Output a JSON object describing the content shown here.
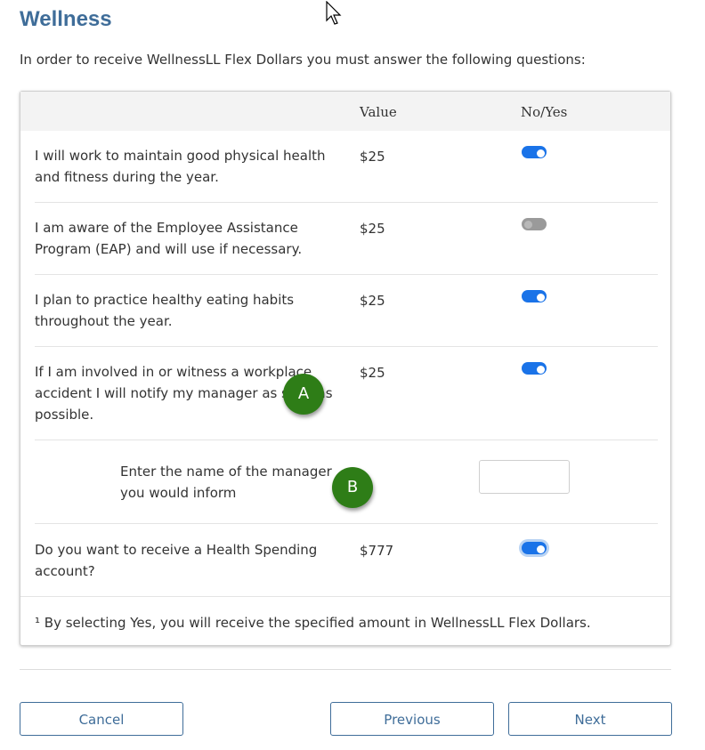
{
  "page": {
    "title": "Wellness",
    "intro": "In order to receive WellnessLL Flex Dollars you must answer the following questions:"
  },
  "table": {
    "headers": {
      "value": "Value",
      "noyes": "No/Yes"
    },
    "rows": [
      {
        "lines": [
          "I will work to maintain good physical health",
          "and fitness during the year."
        ],
        "value": "$25",
        "toggle": "on"
      },
      {
        "lines": [
          "I am aware of the Employee Assistance",
          "Program (EAP) and will use if necessary."
        ],
        "value": "$25",
        "toggle": "off"
      },
      {
        "lines": [
          "I plan to practice healthy eating habits",
          "throughout the year."
        ],
        "value": "$25",
        "toggle": "on"
      },
      {
        "lines": [
          "If I am involved in or witness a workplace",
          "accident I will notify my manager as soon as",
          "possible."
        ],
        "value": "$25",
        "toggle": "on"
      },
      {
        "lines": [
          "Do you want to receive a Health Spending",
          "account?"
        ],
        "value": "$777",
        "toggle": "on"
      }
    ],
    "subquestion": {
      "lines": [
        "Enter the name of the manager",
        "you would inform"
      ],
      "input_value": ""
    },
    "footnote": "¹ By selecting Yes, you will receive the specified amount in WellnessLL Flex Dollars."
  },
  "markers": {
    "a": "A",
    "b": "B"
  },
  "buttons": {
    "cancel": "Cancel",
    "previous": "Previous",
    "next": "Next"
  },
  "colors": {
    "accent": "#3f6d99",
    "toggle_on": "#1a73e8",
    "marker": "#2e7d17"
  }
}
